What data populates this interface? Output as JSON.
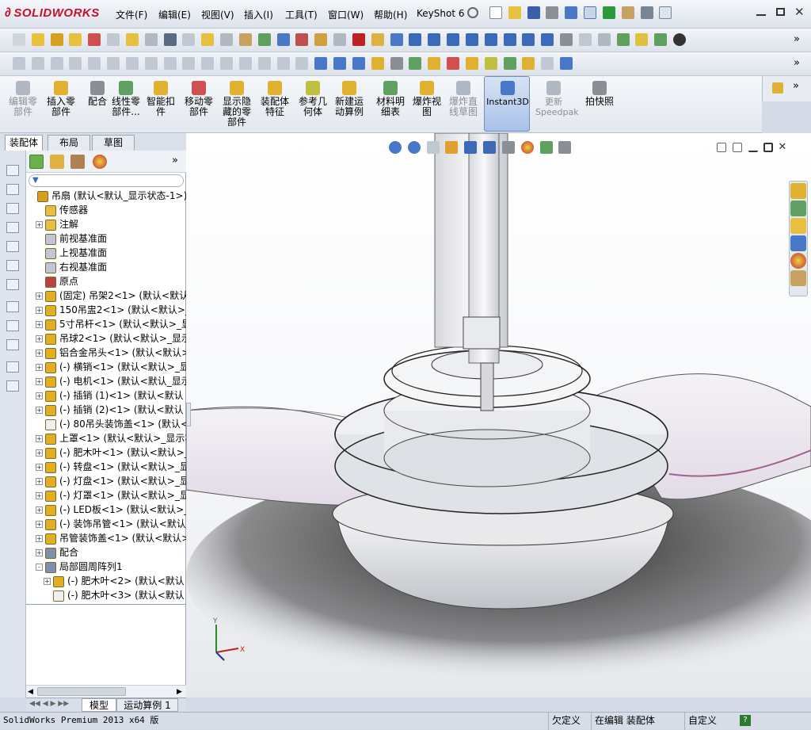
{
  "app": {
    "logo": "SOLIDWORKS"
  },
  "menu": [
    "文件(F)",
    "编辑(E)",
    "视图(V)",
    "插入(I)",
    "工具(T)",
    "窗口(W)",
    "帮助(H)",
    "KeyShot 6"
  ],
  "command_manager": [
    {
      "label": "编辑零\n部件",
      "disabled": true
    },
    {
      "label": "插入零\n部件",
      "disabled": false
    },
    {
      "label": "配合",
      "disabled": false
    },
    {
      "label": "线性零\n部件...",
      "disabled": false
    },
    {
      "label": "智能扣\n件",
      "disabled": false
    },
    {
      "label": "移动零\n部件",
      "disabled": false
    },
    {
      "label": "显示隐\n藏的零\n部件",
      "disabled": false
    },
    {
      "label": "装配体\n特征",
      "disabled": false
    },
    {
      "label": "参考几\n何体",
      "disabled": false
    },
    {
      "label": "新建运\n动算例",
      "disabled": false
    },
    {
      "label": "材料明\n细表",
      "disabled": false
    },
    {
      "label": "爆炸视\n图",
      "disabled": false
    },
    {
      "label": "爆炸直\n线草图",
      "disabled": true
    },
    {
      "label": "Instant3D",
      "disabled": false
    },
    {
      "label": "更新\nSpeedpak",
      "disabled": true
    },
    {
      "label": "拍快照",
      "disabled": false
    }
  ],
  "tabs": [
    "装配体",
    "布局",
    "草图"
  ],
  "tree": [
    {
      "label": "吊扇 (默认<默认_显示状态-1>)",
      "indent": 0,
      "exp": "",
      "icon": "#d8a020"
    },
    {
      "label": "传感器",
      "indent": 1,
      "exp": "",
      "icon": "#e8c040"
    },
    {
      "label": "注解",
      "indent": 1,
      "exp": "+",
      "icon": "#e8c040"
    },
    {
      "label": "前视基准面",
      "indent": 1,
      "exp": "",
      "icon": "#c0c8d4"
    },
    {
      "label": "上视基准面",
      "indent": 1,
      "exp": "",
      "icon": "#c0c8d4"
    },
    {
      "label": "右视基准面",
      "indent": 1,
      "exp": "",
      "icon": "#c0c8d4"
    },
    {
      "label": "原点",
      "indent": 1,
      "exp": "",
      "icon": "#c04040"
    },
    {
      "label": "(固定) 吊架2<1> (默认<默认",
      "indent": 1,
      "exp": "+",
      "icon": "#e0b020"
    },
    {
      "label": "150吊盅2<1> (默认<默认>_显",
      "indent": 1,
      "exp": "+",
      "icon": "#e0b020"
    },
    {
      "label": "5寸吊杆<1> (默认<默认>_显示",
      "indent": 1,
      "exp": "+",
      "icon": "#e0b020"
    },
    {
      "label": "吊球2<1> (默认<默认>_显示状",
      "indent": 1,
      "exp": "+",
      "icon": "#e0b020"
    },
    {
      "label": "铝合金吊头<1> (默认<默认>_",
      "indent": 1,
      "exp": "+",
      "icon": "#e0b020"
    },
    {
      "label": "(-) 横销<1> (默认<默认>_显",
      "indent": 1,
      "exp": "+",
      "icon": "#e0b020"
    },
    {
      "label": "(-) 电机<1> (默认<默认_显示",
      "indent": 1,
      "exp": "+",
      "icon": "#e0b020"
    },
    {
      "label": "(-) 插销 (1)<1> (默认<默认",
      "indent": 1,
      "exp": "+",
      "icon": "#e0b020"
    },
    {
      "label": "(-) 插销 (2)<1> (默认<默认",
      "indent": 1,
      "exp": "+",
      "icon": "#e0b020"
    },
    {
      "label": "(-) 80吊头装饰盖<1> (默认<<",
      "indent": 1,
      "exp": "",
      "icon": "#f0f0f0"
    },
    {
      "label": "上罩<1> (默认<默认>_显示状",
      "indent": 1,
      "exp": "+",
      "icon": "#e0b020"
    },
    {
      "label": "(-) 肥木叶<1> (默认<默认>_",
      "indent": 1,
      "exp": "+",
      "icon": "#e0b020"
    },
    {
      "label": "(-) 转盘<1> (默认<默认>_显",
      "indent": 1,
      "exp": "+",
      "icon": "#e0b020"
    },
    {
      "label": "(-) 灯盘<1> (默认<默认>_显",
      "indent": 1,
      "exp": "+",
      "icon": "#e0b020"
    },
    {
      "label": "(-) 灯罩<1> (默认<默认>_显",
      "indent": 1,
      "exp": "+",
      "icon": "#e0b020"
    },
    {
      "label": "(-) LED板<1> (默认<默认>_显",
      "indent": 1,
      "exp": "+",
      "icon": "#e0b020"
    },
    {
      "label": "(-) 装饰吊管<1> (默认<默认",
      "indent": 1,
      "exp": "+",
      "icon": "#e0b020"
    },
    {
      "label": "吊管装饰盖<1> (默认<默认>_",
      "indent": 1,
      "exp": "+",
      "icon": "#e0b020"
    },
    {
      "label": "配合",
      "indent": 1,
      "exp": "+",
      "icon": "#8090a8"
    },
    {
      "label": "局部圆周阵列1",
      "indent": 1,
      "exp": "-",
      "icon": "#8090a8"
    },
    {
      "label": "(-) 肥木叶<2> (默认<默认",
      "indent": 2,
      "exp": "+",
      "icon": "#e0b020"
    },
    {
      "label": "(-) 肥木叶<3> (默认<默认",
      "indent": 2,
      "exp": "",
      "icon": "#f0f0f0"
    }
  ],
  "bottom_tabs": [
    "模型",
    "运动算例 1"
  ],
  "status": {
    "left": "SolidWorks Premium 2013 x64 版",
    "s1": "欠定义",
    "s2": "在编辑 装配体",
    "s3": "自定义",
    "help": "?"
  }
}
